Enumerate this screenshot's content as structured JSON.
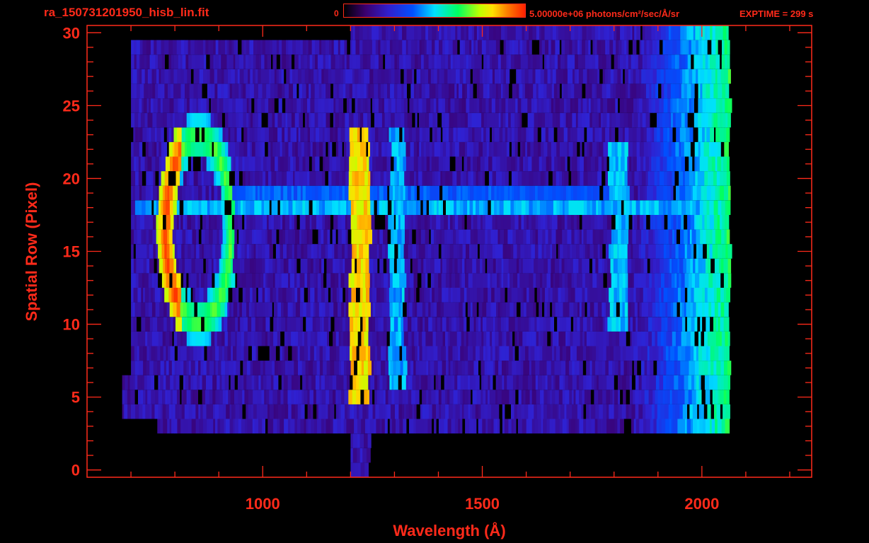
{
  "header": {
    "file_title": "ra_150731201950_hisb_lin.fit",
    "colorbar_min": "0",
    "colorbar_max": "5.00000e+06 photons/cm²/sec/Å/sr",
    "exptime": "EXPTIME = 299 s"
  },
  "colors": {
    "text": "#ff2a1a",
    "background": "#000000"
  },
  "chart_data": {
    "type": "heatmap",
    "title": "ra_150731201950_hisb_lin.fit",
    "xlabel": "Wavelength (Å)",
    "ylabel": "Spatial Row (Pixel)",
    "xlim": [
      600,
      2250
    ],
    "ylim": [
      -0.5,
      30.5
    ],
    "x_ticks": [
      "1000",
      "1500",
      "2000"
    ],
    "y_ticks": [
      "0",
      "5",
      "10",
      "15",
      "20",
      "25",
      "30"
    ],
    "x_tick_values": [
      1000,
      1500,
      2000
    ],
    "y_tick_values": [
      0,
      5,
      10,
      15,
      20,
      25,
      30
    ],
    "colorbar": {
      "min": 0,
      "max": 5000000,
      "units": "photons/cm²/sec/Å/sr"
    },
    "grid": false,
    "features": [
      {
        "wavelength": 1216,
        "rows": [
          5,
          23
        ]
      },
      {
        "wavelength": 800,
        "rows": [
          10,
          23
        ]
      },
      {
        "wavelength": 1304,
        "rows": [
          6,
          23
        ]
      },
      {
        "wavelength": 1800,
        "rows": [
          10,
          22
        ]
      },
      {
        "wavelength": 2050,
        "rows": [
          2,
          30
        ]
      }
    ]
  }
}
